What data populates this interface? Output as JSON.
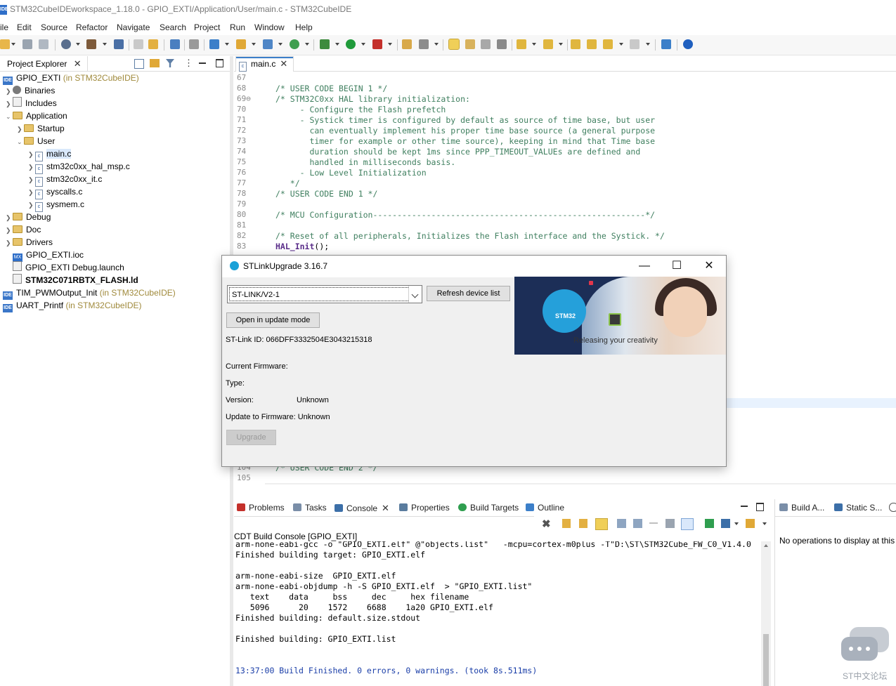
{
  "window": {
    "title": "STM32CubeIDEworkspace_1.18.0 - GPIO_EXTI/Application/User/main.c - STM32CubeIDE",
    "icon_text": "IDE"
  },
  "menu": [
    "ile",
    "Edit",
    "Source",
    "Refactor",
    "Navigate",
    "Search",
    "Project",
    "Run",
    "Window",
    "Help"
  ],
  "project_explorer": {
    "tab_label": "Project Explorer",
    "tree": [
      {
        "label": "GPIO_EXTI",
        "suffix": " (in STM32CubeIDE)",
        "icon": "ide-project-icon"
      },
      {
        "label": "Binaries",
        "icon": "binaries-icon"
      },
      {
        "label": "Includes",
        "icon": "includes-icon"
      },
      {
        "label": "Application",
        "icon": "folder-icon"
      },
      {
        "label": "Startup",
        "icon": "folder-icon"
      },
      {
        "label": "User",
        "icon": "folder-icon"
      },
      {
        "label": "main.c",
        "icon": "c-file-icon"
      },
      {
        "label": "stm32c0xx_hal_msp.c",
        "icon": "c-file-icon"
      },
      {
        "label": "stm32c0xx_it.c",
        "icon": "c-file-icon"
      },
      {
        "label": "syscalls.c",
        "icon": "c-file-icon"
      },
      {
        "label": "sysmem.c",
        "icon": "c-file-icon"
      },
      {
        "label": "Debug",
        "icon": "folder-icon"
      },
      {
        "label": "Doc",
        "icon": "folder-icon"
      },
      {
        "label": "Drivers",
        "icon": "folder-icon"
      },
      {
        "label": "GPIO_EXTI.ioc",
        "icon": "ioc-file-icon",
        "icon_text": "MX"
      },
      {
        "label": "GPIO_EXTI Debug.launch",
        "icon": "launch-file-icon"
      },
      {
        "label": "STM32C071RBTX_FLASH.ld",
        "icon": "linker-file-icon"
      },
      {
        "label": "TIM_PWMOutput_Init",
        "suffix": " (in STM32CubeIDE)",
        "icon": "ide-project-icon"
      },
      {
        "label": "UART_Printf",
        "suffix": " (in STM32CubeIDE)",
        "icon": "ide-project-icon"
      }
    ]
  },
  "editor": {
    "tab_label": "main.c",
    "line_numbers": [
      "67",
      "68",
      "69⊖",
      "70",
      "71",
      "72",
      "73",
      "74",
      "75",
      "76",
      "77",
      "78",
      "79",
      "80",
      "81",
      "82",
      "83"
    ],
    "lines": [
      "",
      "/* USER CODE BEGIN 1 */",
      "/* STM32C0xx HAL library initialization:",
      "     - Configure the Flash prefetch",
      "     - Systick timer is configured by default as source of time base, but user",
      "       can eventually implement his proper time base source (a general purpose",
      "       timer for example or other time source), keeping in mind that Time base",
      "       duration should be kept 1ms since PPP_TIMEOUT_VALUEs are defined and",
      "       handled in milliseconds basis.",
      "     - Low Level Initialization",
      "   */",
      "/* USER CODE END 1 */",
      "",
      "/* MCU Configuration--------------------------------------------------------*/",
      "",
      "/* Reset of all peripherals, Initializes the Flash interface and the Systick. */",
      ""
    ],
    "code_line_83": {
      "fn": "HAL_Init",
      "rest": "();"
    },
    "line_numbers_bottom": [
      "104",
      "105"
    ],
    "line_104": "/* USER CODE END 2 */"
  },
  "bottom_tabs": [
    "Problems",
    "Tasks",
    "Console",
    "Properties",
    "Build Targets",
    "Outline"
  ],
  "console": {
    "title": "CDT Build Console [GPIO_EXTI]",
    "lines": [
      "arm-none-eabi-gcc -o \"GPIO_EXTI.elf\" @\"objects.list\"   -mcpu=cortex-m0plus -T\"D:\\ST\\STM32Cube_FW_C0_V1.4.0",
      "Finished building target: GPIO_EXTI.elf",
      "",
      "arm-none-eabi-size  GPIO_EXTI.elf",
      "arm-none-eabi-objdump -h -S GPIO_EXTI.elf  > \"GPIO_EXTI.list\"",
      "   text    data     bss     dec     hex filename",
      "   5096      20    1572    6688    1a20 GPIO_EXTI.elf",
      "Finished building: default.size.stdout",
      "",
      "Finished building: GPIO_EXTI.list",
      "",
      "",
      "13:37:00 Build Finished. 0 errors, 0 warnings. (took 8s.511ms)"
    ]
  },
  "right_panel": {
    "tabs": [
      "Build A...",
      "Static S..."
    ],
    "message": "No operations to display at this"
  },
  "dialog": {
    "title": "STLinkUpgrade 3.16.7",
    "device_selected": "ST-LINK/V2-1",
    "refresh_label": "Refresh device list",
    "update_mode_label": "Open in update mode",
    "stlink_id": "ST-Link ID: 066DFF3332504E3043215318",
    "current_firmware_label": "Current Firmware:",
    "type_label": "Type:",
    "version_label": "Version:",
    "version_value": "Unknown",
    "update_to_label": "Update to Firmware: Unknown",
    "upgrade_label": "Upgrade",
    "banner_stm": "STM32",
    "banner_caption": "Releasing your creativity"
  },
  "watermark": {
    "text": "ST中文论坛"
  },
  "colors": {
    "accent": "#3c7fc9",
    "comment": "#3f7f5f",
    "keyword": "#5a2d8a",
    "console_finished": "#1a3ea8"
  }
}
